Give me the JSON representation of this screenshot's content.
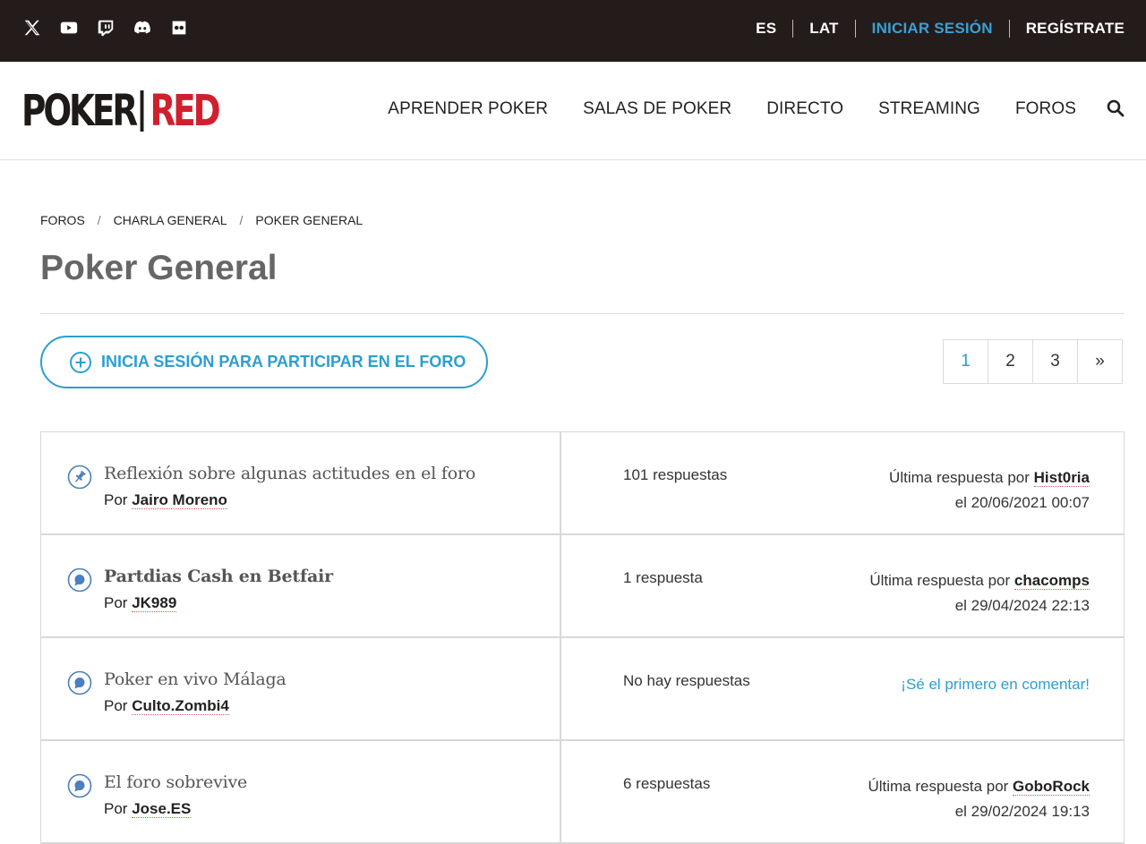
{
  "topbar": {
    "social": [
      "x-icon",
      "youtube-icon",
      "twitch-icon",
      "discord-icon",
      "flickr-icon"
    ],
    "lang_es": "ES",
    "lang_lat": "LAT",
    "login": "INICIAR SESIÓN",
    "register": "REGÍSTRATE"
  },
  "header": {
    "logo_left": "POKER",
    "logo_right": "RED",
    "nav": [
      "APRENDER POKER",
      "SALAS DE POKER",
      "DIRECTO",
      "STREAMING",
      "FOROS"
    ]
  },
  "breadcrumb": [
    "FOROS",
    "CHARLA GENERAL",
    "POKER GENERAL"
  ],
  "page_title": "Poker General",
  "join_button": "INICIA SESIÓN PARA PARTICIPAR EN EL FORO",
  "pagination": [
    "1",
    "2",
    "3",
    "»"
  ],
  "threads": [
    {
      "icon": "pin-icon",
      "title": "Reflexión sobre algunas actitudes en el foro",
      "by_prefix": "Por",
      "author": "Jairo Moreno",
      "replies": "101 respuestas",
      "last_prefix": "Última respuesta por",
      "last_user": "Hist0ria",
      "last_date": "el 20/06/2021 00:07"
    },
    {
      "icon": "chat-icon",
      "title": "Partdias Cash en Betfair",
      "by_prefix": "Por",
      "author": "JK989",
      "replies": "1 respuesta",
      "last_prefix": "Última respuesta por",
      "last_user": "chacomps",
      "last_date": "el 29/04/2024 22:13"
    },
    {
      "icon": "chat-icon",
      "title": "Poker en vivo Málaga",
      "by_prefix": "Por",
      "author": "Culto.Zombi4",
      "replies": "No hay respuestas",
      "first_comment": "¡Sé el primero en comentar!"
    },
    {
      "icon": "chat-icon",
      "title": "El foro sobrevive",
      "by_prefix": "Por",
      "author": "Jose.ES",
      "replies": "6 respuestas",
      "last_prefix": "Última respuesta por",
      "last_user": "GoboRock",
      "last_date": "el 29/02/2024 19:13"
    }
  ]
}
